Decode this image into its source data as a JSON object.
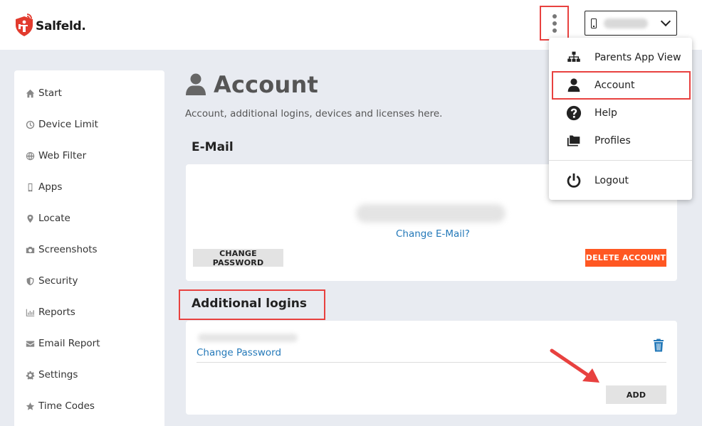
{
  "header": {
    "logo_text": "Salfeld.",
    "device_name": "·······"
  },
  "sidebar": {
    "items": [
      {
        "label": "Start",
        "icon": "home-icon"
      },
      {
        "label": "Device Limit",
        "icon": "clock-icon"
      },
      {
        "label": "Web Filter",
        "icon": "globe-icon"
      },
      {
        "label": "Apps",
        "icon": "mobile-icon"
      },
      {
        "label": "Locate",
        "icon": "map-marker-icon"
      },
      {
        "label": "Screenshots",
        "icon": "camera-icon"
      },
      {
        "label": "Security",
        "icon": "shield-icon"
      },
      {
        "label": "Reports",
        "icon": "bar-chart-icon"
      },
      {
        "label": "Email Report",
        "icon": "envelope-icon"
      },
      {
        "label": "Settings",
        "icon": "gear-icon"
      },
      {
        "label": "Time Codes",
        "icon": "star-icon"
      }
    ]
  },
  "main": {
    "title": "Account",
    "subtitle": "Account, additional logins, devices and licenses here.",
    "email_section": {
      "title": "E-Mail",
      "change_email_label": "Change E-Mail?",
      "change_password_label": "CHANGE PASSWORD",
      "delete_account_label": "DELETE ACCOUNT"
    },
    "logins_section": {
      "title": "Additional logins",
      "change_password_link": "Change Password",
      "add_label": "ADD"
    }
  },
  "menu": {
    "items": [
      {
        "label": "Parents App View",
        "icon": "sitemap-icon"
      },
      {
        "label": "Account",
        "icon": "user-icon"
      },
      {
        "label": "Help",
        "icon": "question-circle-icon"
      },
      {
        "label": "Profiles",
        "icon": "folders-icon"
      },
      {
        "label": "Logout",
        "icon": "power-icon"
      }
    ]
  },
  "colors": {
    "accent_blue": "#2479b9",
    "danger_orange": "#ff5722",
    "highlight_red": "#e8413f",
    "background": "#e8ebf1"
  }
}
